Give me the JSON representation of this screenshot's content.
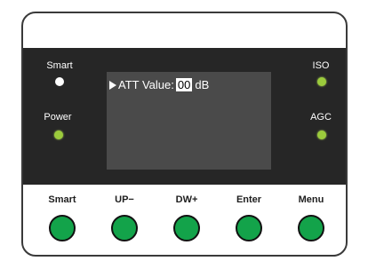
{
  "indicators": {
    "smart_label": "Smart",
    "power_label": "Power",
    "iso_label": "ISO",
    "agc_label": "AGC"
  },
  "display": {
    "att_label": "ATT Value:",
    "att_value": "00",
    "att_unit": "dB"
  },
  "buttons": {
    "smart": "Smart",
    "up": "UP−",
    "down": "DW+",
    "enter": "Enter",
    "menu": "Menu"
  },
  "colors": {
    "panel": "#262626",
    "screen": "#4a4a4a",
    "led_green": "#9bcb3c",
    "button_green": "#13a34a"
  }
}
